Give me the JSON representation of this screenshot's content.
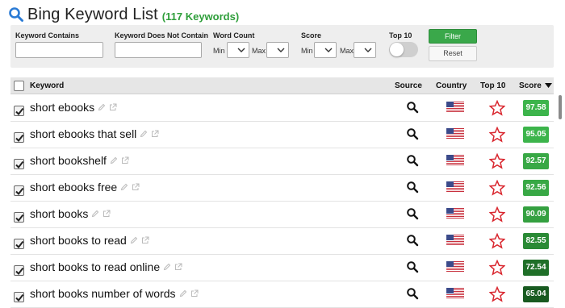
{
  "header": {
    "title": "Bing Keyword List",
    "count": "(117 Keywords)"
  },
  "filters": {
    "keyword_contains_label": "Keyword Contains",
    "keyword_not_contains_label": "Keyword Does Not Contain",
    "word_count_label": "Word Count",
    "score_label": "Score",
    "top10_label": "Top 10",
    "min_label": "Min",
    "max_label": "Max",
    "top10_toggle_on": false,
    "filter_button": "Filter",
    "reset_button": "Reset"
  },
  "table": {
    "columns": {
      "keyword": "Keyword",
      "source": "Source",
      "country": "Country",
      "top10": "Top 10",
      "score": "Score"
    },
    "rows": [
      {
        "keyword": "short ebooks",
        "score": "97.58",
        "color": "#3cb44b",
        "checked": true
      },
      {
        "keyword": "short ebooks that sell",
        "score": "95.05",
        "color": "#3cb44b",
        "checked": true
      },
      {
        "keyword": "short bookshelf",
        "score": "92.57",
        "color": "#38a845",
        "checked": true
      },
      {
        "keyword": "short ebooks free",
        "score": "92.56",
        "color": "#38a845",
        "checked": true
      },
      {
        "keyword": "short books",
        "score": "90.09",
        "color": "#34a040",
        "checked": true
      },
      {
        "keyword": "short books to read",
        "score": "82.55",
        "color": "#2a8a35",
        "checked": true
      },
      {
        "keyword": "short books to read online",
        "score": "72.54",
        "color": "#1f6f28",
        "checked": true
      },
      {
        "keyword": "short books number of words",
        "score": "65.04",
        "color": "#185a20",
        "checked": true
      }
    ]
  },
  "icons": {
    "header": "search-icon",
    "edit": "pencil-icon",
    "open": "external-link-icon",
    "source": "search-icon",
    "country": "us-flag-icon",
    "top10": "star-outline-icon"
  },
  "colors": {
    "accent_blue": "#2a7bd5",
    "count_green": "#2e9e3a",
    "star_red": "#d9262e"
  }
}
